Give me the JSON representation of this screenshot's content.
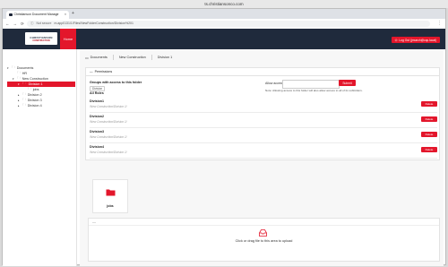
{
  "mac_title": "ts.christiansonco.com",
  "browser": {
    "tab_title": "Christianson Document Manage",
    "tab_close": "×",
    "new_tab": "+",
    "secure_label": "Not secure",
    "url": "m.app0131/1/Files/NewFolderConstruction/Division%201"
  },
  "header": {
    "logo_line1": "CHRISTIANSON",
    "logo_line2": "CONSTRUCTION",
    "home_label": "Home",
    "logout_label": "Log Out (jmunch@cqc.local)"
  },
  "sidebar": {
    "root": "Documents",
    "items": [
      {
        "label": "HR"
      },
      {
        "label": "New Construction"
      },
      {
        "label": "Division 1"
      },
      {
        "label": "jobs"
      },
      {
        "label": "Division 2"
      },
      {
        "label": "Division 3"
      },
      {
        "label": "Division 4"
      }
    ]
  },
  "breadcrumb": [
    "Documents",
    "New Construction",
    "Division 1"
  ],
  "permissions": {
    "title": "Permissions",
    "groups_title": "Groups with access to this folder",
    "groups_badge": "Division",
    "all_roles": "All Roles",
    "allow_label": "Allow access to:",
    "allow_placeholder": "",
    "submit_label": "Submit",
    "note": "Note: Allowing access to this folder will also allow access to all of its subfolders.",
    "delete_label": "Delete",
    "roles": [
      {
        "name": "Division1",
        "path": "/New Construction/Division 1/"
      },
      {
        "name": "Division2",
        "path": "/New Construction/Division 1/"
      },
      {
        "name": "Division3",
        "path": "/New Construction/Division 1/"
      },
      {
        "name": "Division4",
        "path": "/New Construction/Division 1/"
      }
    ]
  },
  "folders": [
    {
      "name": "jobs"
    }
  ],
  "upload": {
    "collapse": "—",
    "text": "Click or drag file to this area to upload"
  },
  "colors": {
    "accent": "#e3162b",
    "header": "#1f2a3c"
  }
}
